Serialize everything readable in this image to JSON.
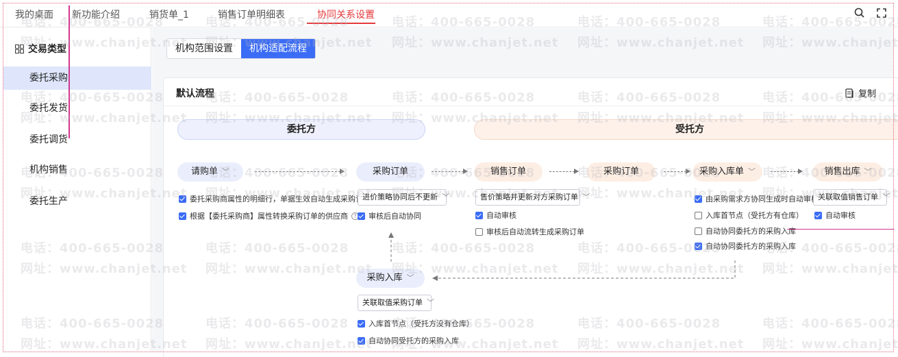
{
  "tabs": [
    "我的桌面",
    "新功能介绍",
    "销货单_1",
    "销售订单明细表",
    "协同关系设置"
  ],
  "sidebar": {
    "title": "交易类型",
    "items": [
      "委托采购",
      "委托发货",
      "委托调货",
      "机构销售",
      "委托生产"
    ]
  },
  "segmented": [
    "机构范围设置",
    "机构适配流程"
  ],
  "card": {
    "title": "默认流程",
    "copy_label": "复制"
  },
  "parties": {
    "client": "委托方",
    "trustee": "受托方"
  },
  "nodes": {
    "purchase_request": "请购单",
    "purchase_order": "采购订单",
    "sales_order": "销售订单",
    "purchase_order_2": "采购订单",
    "purchase_receipt_order": "采购入库单",
    "sales_outbound": "销售出库",
    "purchase_inbound": "采购入库"
  },
  "options": {
    "o1": "委托采购商属性的明细行，单据生效自动生成采购订单",
    "o2": "根据【委托采购商】属性转换采购订单的供应商",
    "o3": "审核后自动协同",
    "o4": "自动审核",
    "o5": "审核后自动流转生成采购订单",
    "o6": "由采购需求方协同生成时自动审核",
    "o7": "入库首节点（受托方有仓库）",
    "o8": "自动协同委托方的采购入库",
    "o9": "自动协同委托方的采购入库",
    "o10": "自动审核",
    "o11": "入库首节点（受托方没有仓库）",
    "o12": "自动协同受托方的采购入库"
  },
  "selects": {
    "s1": "进价策略协同后不更新",
    "s2": "售价策略并更新对方采购订单",
    "s3": "关联取值销售订单",
    "s4": "关联取值采购订单"
  },
  "watermark": {
    "phone": "电话：400-665-0028",
    "site": "网址：www.chanjet.net"
  },
  "colors": {
    "accent": "#3b6cf6",
    "active_tab": "#e5383b"
  }
}
